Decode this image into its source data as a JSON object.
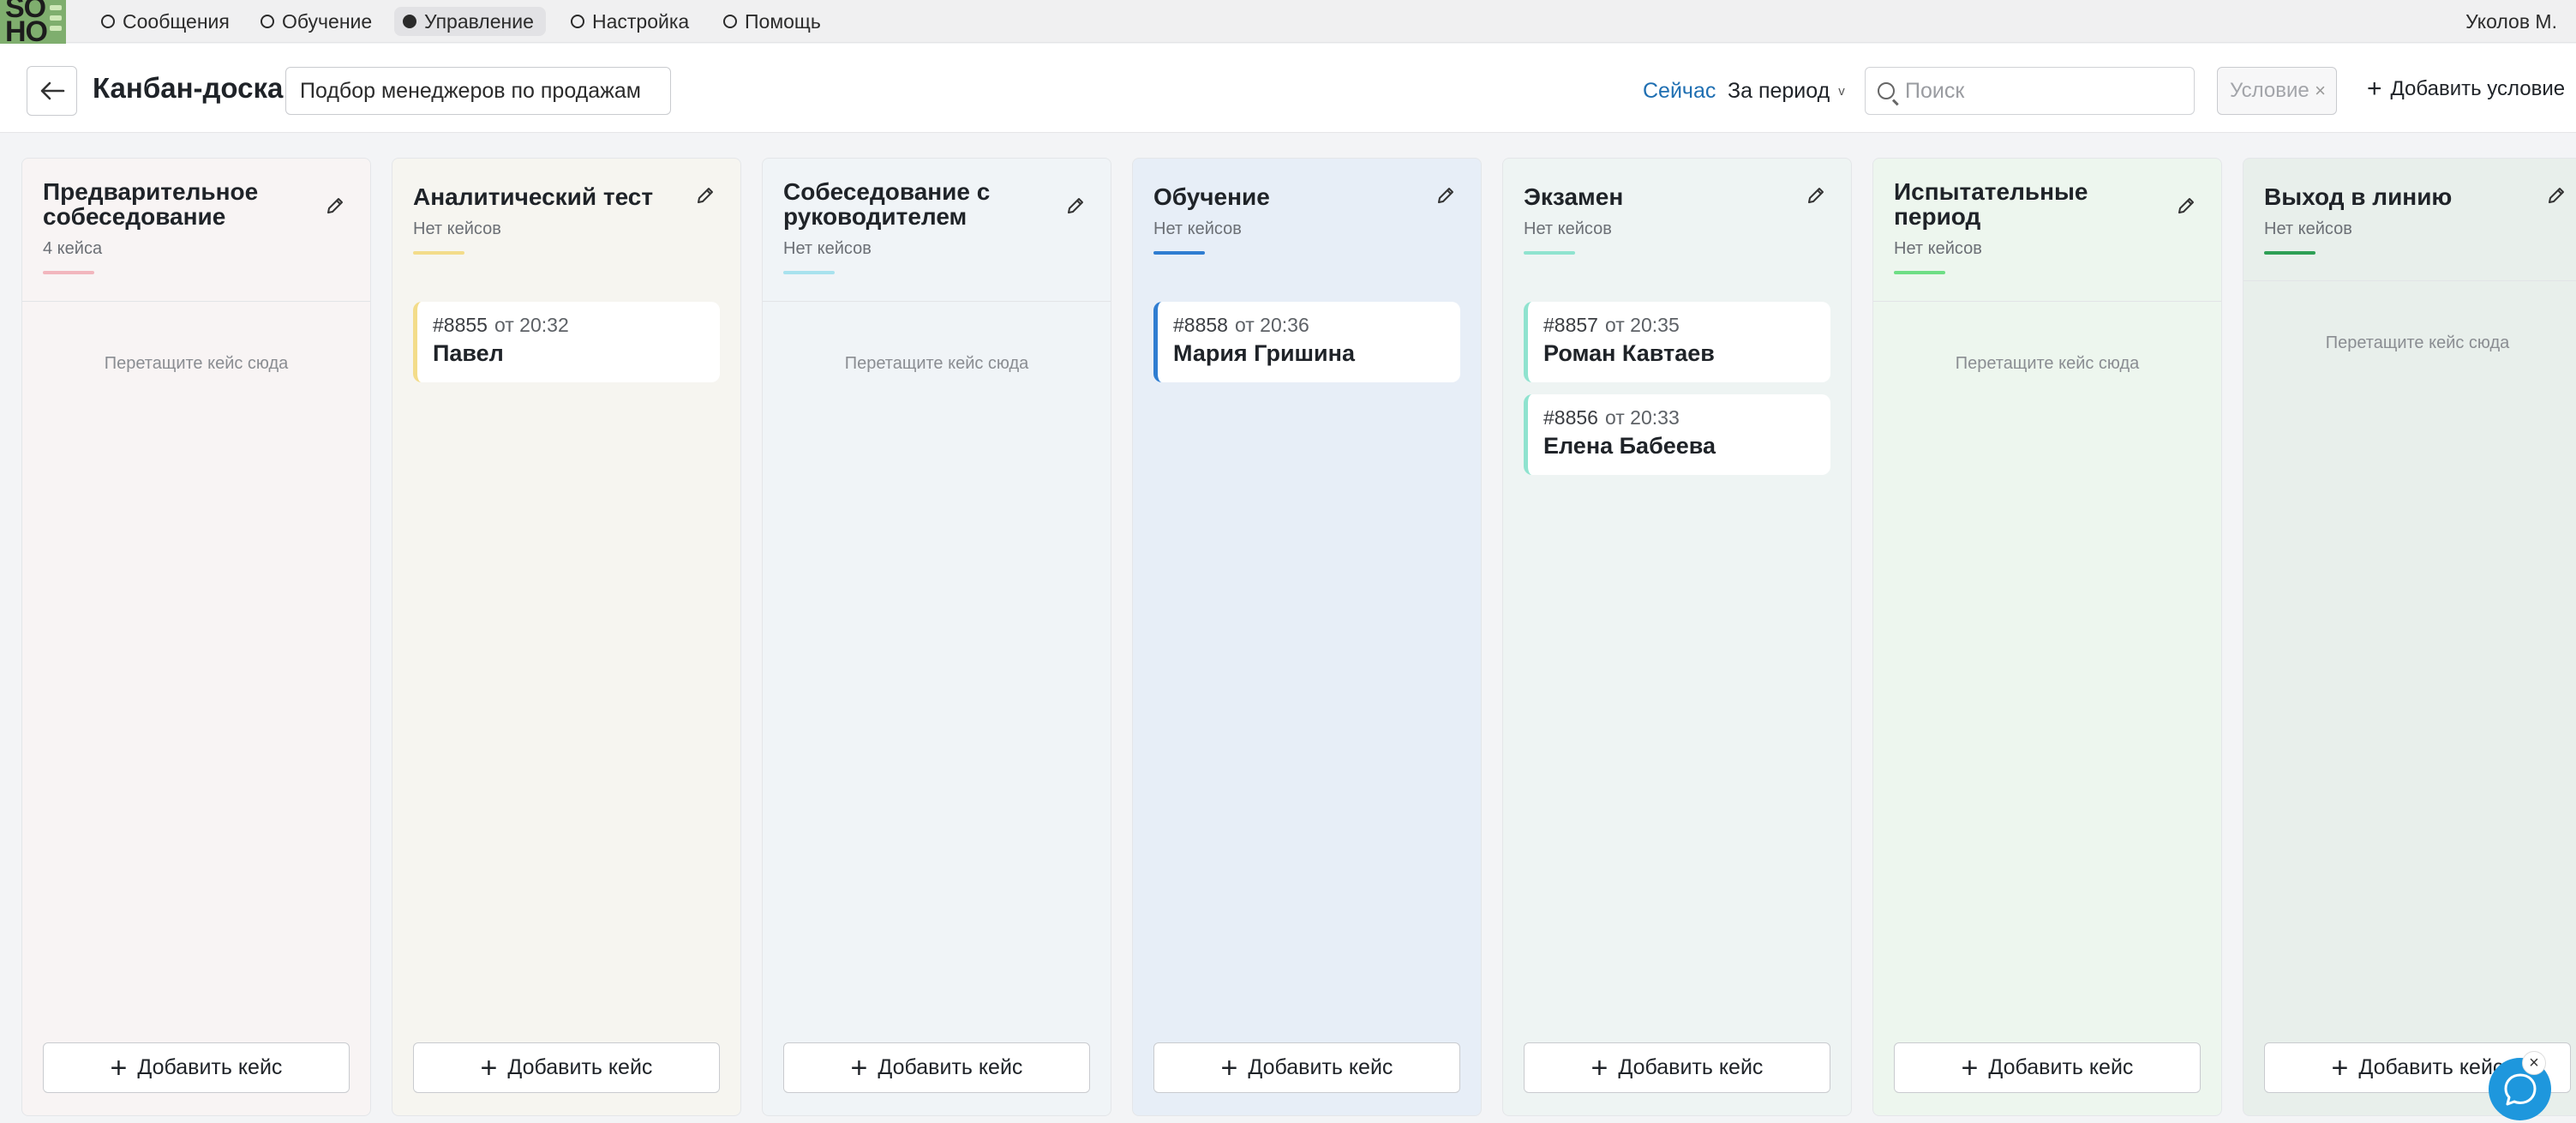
{
  "logo": {
    "text_top": "SO",
    "text_bottom": "HO"
  },
  "topnav": {
    "items": [
      {
        "label": "Сообщения",
        "active": false
      },
      {
        "label": "Обучение",
        "active": false
      },
      {
        "label": "Управление",
        "active": true
      },
      {
        "label": "Настройка",
        "active": false
      },
      {
        "label": "Помощь",
        "active": false
      }
    ],
    "user": "Уколов М."
  },
  "header": {
    "back_icon": "arrow-left-icon",
    "title": "Канбан-доска",
    "board": "Подбор менеджеров по продажам",
    "now_label": "Сейчас",
    "period_label": "За период",
    "search_placeholder": "Поиск",
    "condition_placeholder": "Условие",
    "add_condition_label": "Добавить условие"
  },
  "columns": [
    {
      "title": "Предварительное собеседование",
      "count": "4 кейса",
      "accent": "#f2b6bd",
      "bg": "#f8f4f4",
      "drop_hint": "Перетащите кейс сюда",
      "cards": []
    },
    {
      "title": "Аналитический тест",
      "count": "Нет кейсов",
      "accent": "#f3dc8a",
      "bg": "#f6f5f0",
      "drop_hint": "",
      "cards": [
        {
          "num": "#8855",
          "time": "от 20:32",
          "name": "Павел"
        }
      ]
    },
    {
      "title": "Собеседование с руководителем",
      "count": "Нет кейсов",
      "accent": "#a8e2ee",
      "bg": "#f0f4f7",
      "drop_hint": "Перетащите кейс сюда",
      "cards": []
    },
    {
      "title": "Обучение",
      "count": "Нет кейсов",
      "accent": "#2f7dd1",
      "bg": "#e7eef7",
      "drop_hint": "",
      "cards": [
        {
          "num": "#8858",
          "time": "от 20:36",
          "name": "Мария Гришина"
        }
      ]
    },
    {
      "title": "Экзамен",
      "count": "Нет кейсов",
      "accent": "#8fe3cf",
      "bg": "#eef4f3",
      "drop_hint": "",
      "cards": [
        {
          "num": "#8857",
          "time": "от 20:35",
          "name": "Роман Кавтаев"
        },
        {
          "num": "#8856",
          "time": "от 20:33",
          "name": "Елена Бабеева"
        }
      ]
    },
    {
      "title": "Испытательные период",
      "count": "Нет кейсов",
      "accent": "#6ede85",
      "bg": "#edf6ee",
      "drop_hint": "Перетащите кейс сюда",
      "cards": []
    },
    {
      "title": "Выход в линию",
      "count": "Нет кейсов",
      "accent": "#2e9f55",
      "bg": "#e8efeb",
      "drop_hint": "Перетащите кейс сюда",
      "cards": []
    }
  ],
  "add_case_label": "Добавить кейс",
  "chat": {
    "icon": "chat-bubble-icon",
    "close_icon": "close-icon"
  }
}
